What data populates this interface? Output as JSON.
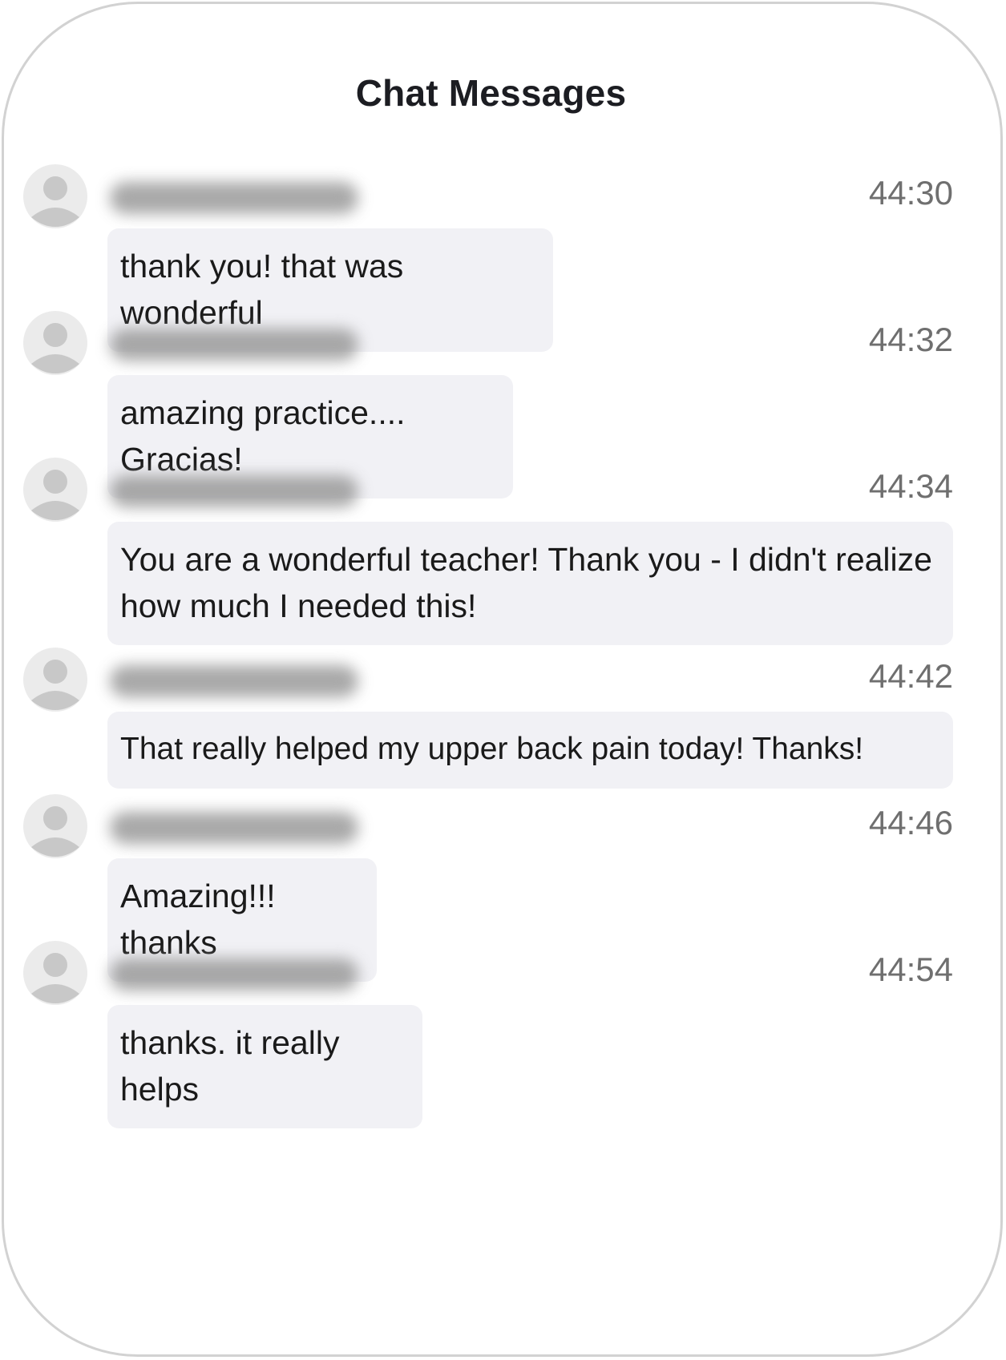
{
  "panel": {
    "title": "Chat Messages"
  },
  "messages": [
    {
      "time": "44:30",
      "text": "thank you! that was wonderful"
    },
    {
      "time": "44:32",
      "text": "amazing practice.... Gracias!"
    },
    {
      "time": "44:34",
      "text": "You are a wonderful teacher! Thank you - I didn't realize how much I needed this!"
    },
    {
      "time": "44:42",
      "text": "That really helped my upper back pain today! Thanks!"
    },
    {
      "time": "44:46",
      "text": "Amazing!!! thanks"
    },
    {
      "time": "44:54",
      "text": "thanks. it really helps"
    }
  ],
  "icons": {
    "avatar": "user-avatar-placeholder-icon"
  },
  "colors": {
    "bubble": "#f1f1f5",
    "avatar": "#c8c8c8",
    "timestamp": "#6f6f6f"
  }
}
